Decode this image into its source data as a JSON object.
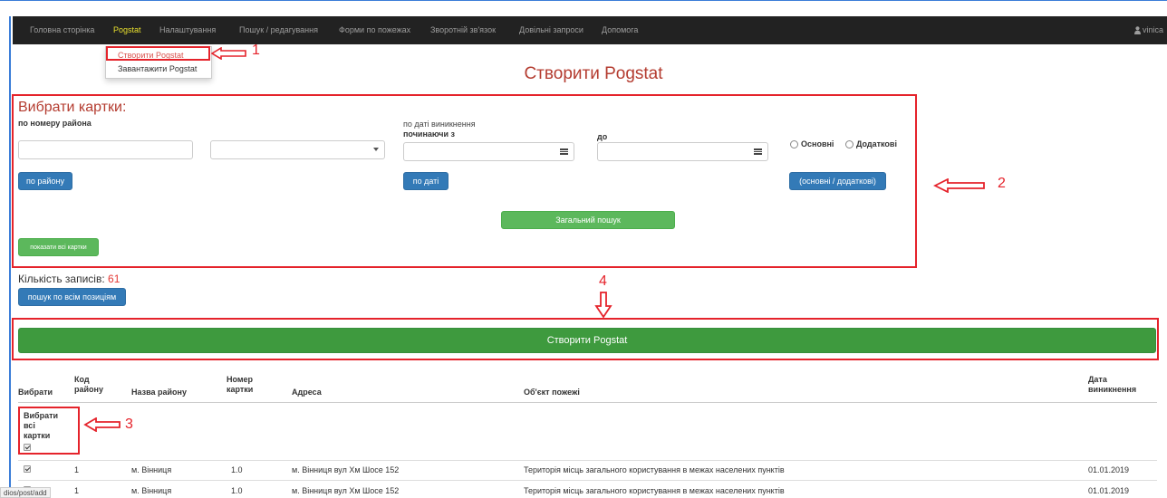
{
  "nav": {
    "items": [
      "Головна сторінка",
      "Pogstat",
      "Налаштування",
      "Пошук / редагування",
      "Форми по пожежах",
      "Зворотній зв'язок",
      "Довільні запроси",
      "Допомога"
    ],
    "user": "vinica"
  },
  "dropdown": {
    "items": [
      "Створити Pogstat",
      "Завантажити Pogstat"
    ]
  },
  "annotations": {
    "n1": "1",
    "n2": "2",
    "n3": "3",
    "n4": "4"
  },
  "page_title": "Створити Pogstat",
  "filters": {
    "heading": "Вибрати картки:",
    "district_label": "по номеру района",
    "date_label": "по даті виникнення",
    "from_label": "починаючи з",
    "to_label": "до",
    "radio_main": "Основні",
    "radio_extra": "Додаткові",
    "btn_district": "по району",
    "btn_date": "по даті",
    "btn_type": "(основні / додаткові)",
    "btn_general": "Загальний пошук",
    "btn_show_all": "показати всі картки"
  },
  "count": {
    "label": "Кількість записів:",
    "value": "61"
  },
  "btn_search_all": "пошук по всім позиціям",
  "btn_create": "Створити Pogstat",
  "table": {
    "headers": {
      "select": "Вибрати",
      "code": [
        "Код",
        "району"
      ],
      "district_name": "Назва району",
      "card_no": [
        "Номер",
        "картки"
      ],
      "address": "Адреса",
      "object": "Об'єкт пожежі",
      "date": [
        "Дата",
        "виникнення"
      ]
    },
    "select_all": [
      "Вибрати",
      "всі",
      "картки"
    ],
    "rows": [
      {
        "code": "1",
        "district": "м. Вінниця",
        "card": "1.0",
        "address": "м. Вінниця вул Хм Шосе 152",
        "object": "Територія місць загального користування в межах населених пунктів",
        "date": "01.01.2019"
      },
      {
        "code": "1",
        "district": "м. Вінниця",
        "card": "1.0",
        "address": "м. Вінниця вул Хм Шосе 152",
        "object": "Територія місць загального користування в межах населених пунктів",
        "date": "01.01.2019"
      }
    ]
  },
  "status_url": "dios/post/add"
}
